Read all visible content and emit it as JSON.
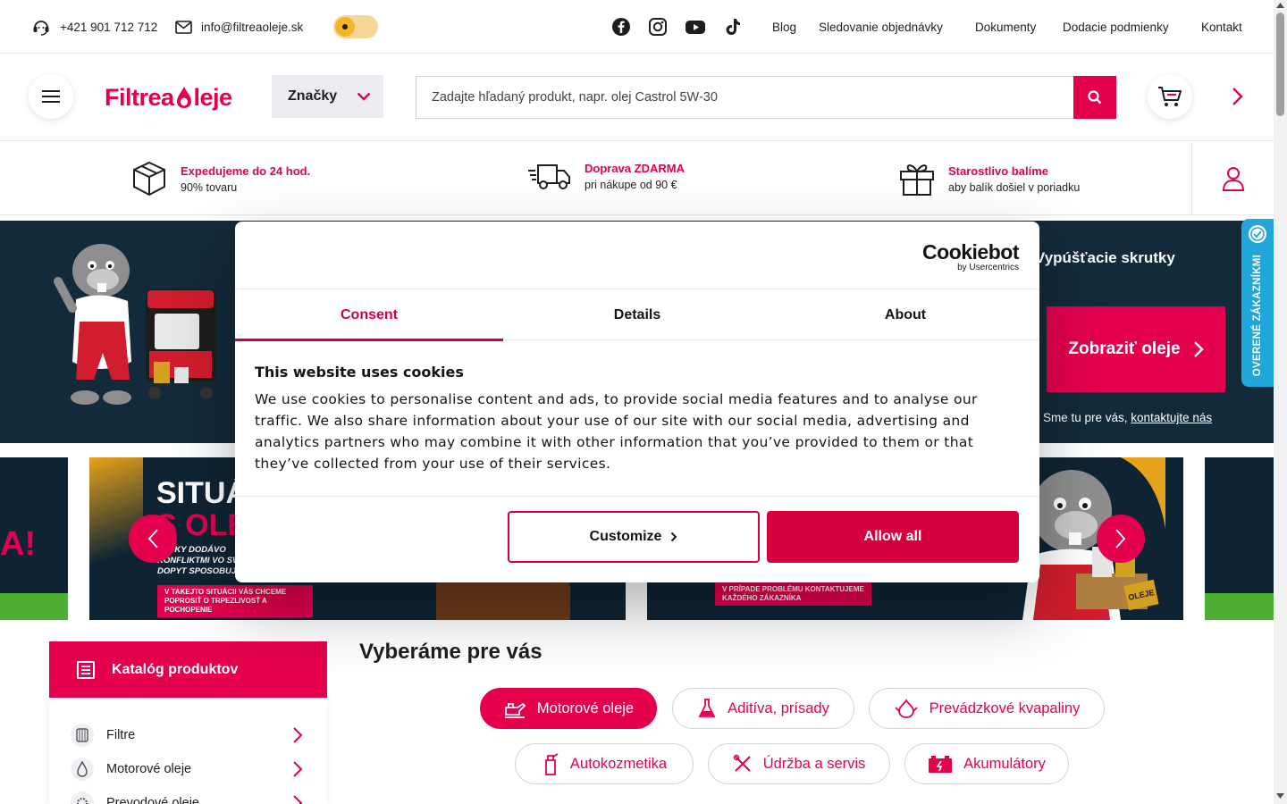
{
  "topbar": {
    "phone": "+421 901 712 712",
    "email": "info@filtreaoleje.sk",
    "links": [
      "Blog",
      "Sledovanie objednávky",
      "Dokumenty",
      "Dodacie podmienky",
      "Kontakt"
    ],
    "socials": [
      "facebook-icon",
      "instagram-icon",
      "youtube-icon",
      "tiktok-icon"
    ]
  },
  "header": {
    "logo_left": "Filtrea",
    "logo_right": "leje",
    "brands_label": "Značky",
    "search_placeholder": "Zadajte hľadaný produkt, napr. olej Castrol 5W-30"
  },
  "benefits": [
    {
      "title": "Expedujeme do 24 hod.",
      "subtitle": "90% tovaru",
      "icon": "box-icon"
    },
    {
      "title": "Doprava ZDARMA",
      "subtitle": "pri nákupe od 90 €",
      "icon": "truck-icon"
    },
    {
      "title": "Starostlivo balíme",
      "subtitle": "aby balík došiel v poriadku",
      "icon": "gift-icon"
    }
  ],
  "promo": {
    "screws": "Vypúšťacie skrutky",
    "cta": "Zobraziť oleje",
    "contact_prefix": "Sme tu pre vás, ",
    "contact_link": "kontaktujte nás"
  },
  "verified_tab": "OVERENÉ ZÁKAZNÍKMI",
  "carousel": {
    "slide_title_white": "SITUÁCI",
    "slide_title_red": "S OLEJM",
    "slide_lines": [
      "PADKY DODÁVO",
      "KONFLIKTMI VO SV",
      "DOPYT SPOSOBUJ"
    ],
    "slide_strip": "V TAKEJTO SITUÁCII VÁS CHCEME POPROSIŤ O TRPEZLIVOSŤ A POCHOPENIE",
    "slide2_strip": "V PRÍPADE PROBLÉMU KONTAKTUJEME KAŽDÉHO ZÁKAZNÍKA",
    "slide_left_text": "A!",
    "box_label": "OLEJE"
  },
  "catalog": {
    "title": "Katalóg produktov",
    "items": [
      "Filtre",
      "Motorové oleje",
      "Prevodové oleje"
    ]
  },
  "picks": {
    "title": "Vyberáme pre vás",
    "row1": [
      "Motorové oleje",
      "Aditíva, prísady",
      "Prevádzkové kvapaliny"
    ],
    "row2": [
      "Autokozmetika",
      "Údržba a servis",
      "Akumulátory"
    ]
  },
  "cookie": {
    "brand": "Cookiebot",
    "brand_sub": "by Usercentrics",
    "tabs": [
      "Consent",
      "Details",
      "About"
    ],
    "active_tab": "Consent",
    "title": "This website uses cookies",
    "text": "We use cookies to personalise content and ads, to provide social media features and to analyse our traffic. We also share information about your use of our site with our social media, advertising and analytics partners who may combine it with other information that you’ve provided to them or that they’ve collected from your use of their services.",
    "customize": "Customize",
    "allow_all": "Allow all"
  },
  "colors": {
    "brand_red": "#e4004f",
    "cookie_red": "#d6003e",
    "navy": "#132a3a",
    "verified_blue": "#21a6d9"
  }
}
